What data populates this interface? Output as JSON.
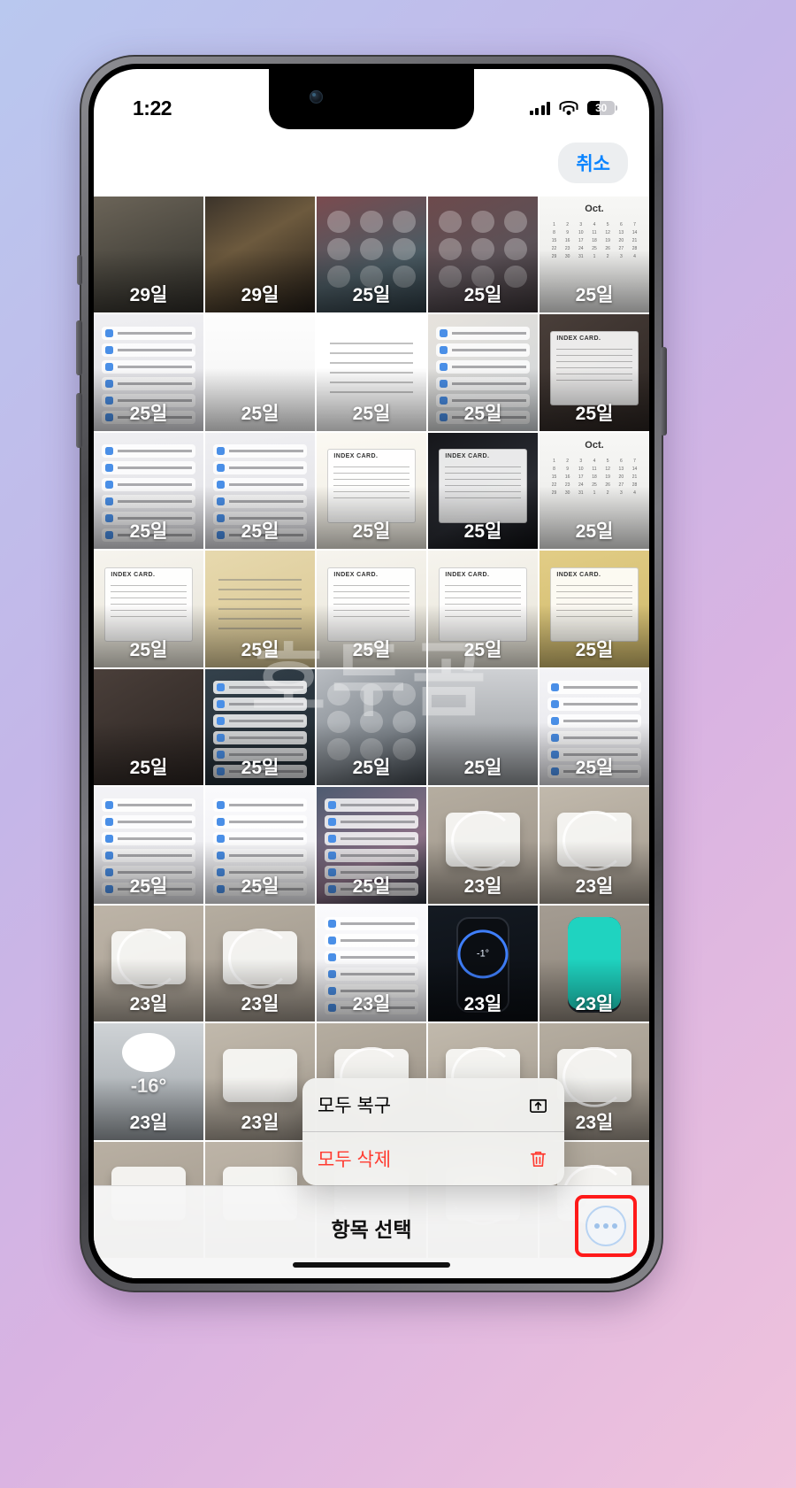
{
  "status_bar": {
    "time": "1:22",
    "battery_percent": "30",
    "cellular_icon": "cellular-bars-icon",
    "wifi_icon": "wifi-icon",
    "battery_icon": "battery-icon"
  },
  "nav_bar": {
    "cancel_label": "취소"
  },
  "watermark": "호두곰",
  "grid": {
    "columns": 5,
    "cells": [
      {
        "day": "29일",
        "style": "t-dark",
        "dec": "none"
      },
      {
        "day": "29일",
        "style": "t-kitchen",
        "dec": "none"
      },
      {
        "day": "25일",
        "style": "t-cc1",
        "dec": "grid3"
      },
      {
        "day": "25일",
        "style": "t-cc2",
        "dec": "grid3"
      },
      {
        "day": "25일",
        "style": "t-cal",
        "dec": "cal"
      },
      {
        "day": "25일",
        "style": "t-menu",
        "dec": "rows"
      },
      {
        "day": "25일",
        "style": "t-white",
        "dec": "none"
      },
      {
        "day": "25일",
        "style": "t-notes",
        "dec": "lines"
      },
      {
        "day": "25일",
        "style": "t-apps",
        "dec": "rows"
      },
      {
        "day": "25일",
        "style": "t-stickers",
        "dec": "index"
      },
      {
        "day": "25일",
        "style": "t-menu",
        "dec": "rows"
      },
      {
        "day": "25일",
        "style": "t-menu",
        "dec": "rows"
      },
      {
        "day": "25일",
        "style": "t-paper",
        "dec": "index"
      },
      {
        "day": "25일",
        "style": "t-card-d",
        "dec": "index"
      },
      {
        "day": "25일",
        "style": "t-cal",
        "dec": "cal"
      },
      {
        "day": "25일",
        "style": "t-index",
        "dec": "index"
      },
      {
        "day": "25일",
        "style": "t-kraft",
        "dec": "lines"
      },
      {
        "day": "25일",
        "style": "t-index",
        "dec": "index"
      },
      {
        "day": "25일",
        "style": "t-index",
        "dec": "index"
      },
      {
        "day": "25일",
        "style": "t-yellow",
        "dec": "index"
      },
      {
        "day": "25일",
        "style": "t-stickers",
        "dec": "none"
      },
      {
        "day": "25일",
        "style": "t-ccdark",
        "dec": "rows"
      },
      {
        "day": "25일",
        "style": "t-wave",
        "dec": "grid3"
      },
      {
        "day": "25일",
        "style": "t-grey",
        "dec": "none"
      },
      {
        "day": "25일",
        "style": "t-settings",
        "dec": "rows"
      },
      {
        "day": "25일",
        "style": "t-settings",
        "dec": "rows"
      },
      {
        "day": "25일",
        "style": "t-settings2",
        "dec": "rows"
      },
      {
        "day": "25일",
        "style": "t-watch",
        "dec": "rows"
      },
      {
        "day": "23일",
        "style": "t-box",
        "dec": "boxcircle"
      },
      {
        "day": "23일",
        "style": "t-box2",
        "dec": "boxcircle"
      },
      {
        "day": "23일",
        "style": "t-measure",
        "dec": "boxcircle"
      },
      {
        "day": "23일",
        "style": "t-box",
        "dec": "boxcircle"
      },
      {
        "day": "23일",
        "style": "t-settings2",
        "dec": "rows"
      },
      {
        "day": "23일",
        "style": "t-phone-dark",
        "dec": "phonering"
      },
      {
        "day": "23일",
        "style": "t-phone-teal",
        "dec": "phoneteal"
      },
      {
        "day": "23일",
        "style": "t-snow",
        "dec": "snow"
      },
      {
        "day": "23일",
        "style": "t-box2",
        "dec": "boxshape"
      },
      {
        "day": "23일",
        "style": "t-box",
        "dec": "boxcircle"
      },
      {
        "day": "23일",
        "style": "t-box2",
        "dec": "boxcircle"
      },
      {
        "day": "23일",
        "style": "t-box",
        "dec": "boxcircle"
      },
      {
        "day": "",
        "style": "t-tape",
        "dec": "boxshape"
      },
      {
        "day": "",
        "style": "t-measure",
        "dec": "boxshape"
      },
      {
        "day": "",
        "style": "t-box",
        "dec": "boxcircle"
      },
      {
        "day": "",
        "style": "t-box2",
        "dec": "boxcircle"
      },
      {
        "day": "",
        "style": "t-box",
        "dec": "boxcircle"
      }
    ],
    "snow_temp": "-16°",
    "phone_temp": "-1°"
  },
  "action_menu": {
    "items": [
      {
        "label": "모두 복구",
        "icon": "restore-tray-icon",
        "destructive": false
      },
      {
        "label": "모두 삭제",
        "icon": "trash-icon",
        "destructive": true
      }
    ]
  },
  "toolbar": {
    "select_label": "항목 선택",
    "more_button_icon": "ellipsis-circle-icon"
  },
  "colors": {
    "accent_blue": "#0a84ff",
    "destructive_red": "#ff3b30",
    "highlight_red": "#ff1a1a",
    "toolbar_bg": "#f6f6f6"
  }
}
